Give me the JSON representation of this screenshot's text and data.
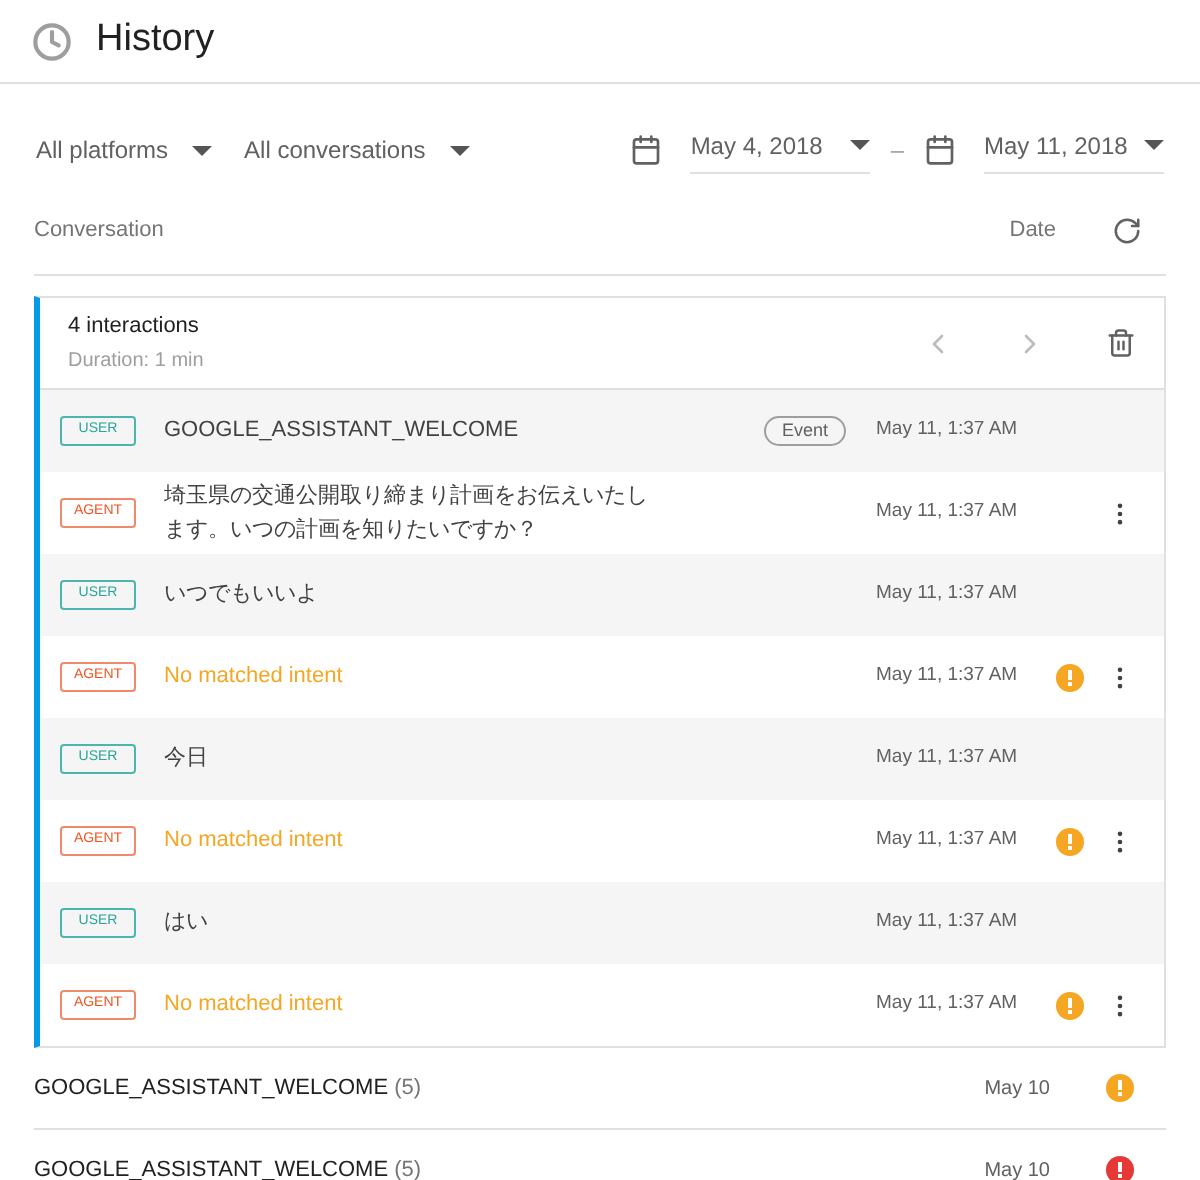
{
  "header": {
    "title": "History"
  },
  "filters": {
    "platform": "All platforms",
    "conversations": "All conversations",
    "date_from": "May 4, 2018",
    "separator": "–",
    "date_to": "May 11, 2018"
  },
  "columns": {
    "conversation": "Conversation",
    "date": "Date"
  },
  "expanded_conversation": {
    "title": "4 interactions",
    "duration": "Duration: 1 min",
    "messages": [
      {
        "kind": "user",
        "badge": "USER",
        "text": "GOOGLE_ASSISTANT_WELCOME",
        "tag": "Event",
        "time": "May 11, 1:37 AM",
        "warning": false,
        "menu": false
      },
      {
        "kind": "agent",
        "badge": "AGENT",
        "text": "埼玉県の交通公開取り締まり計画をお伝えいたします。いつの計画を知りたいですか？",
        "time": "May 11, 1:37 AM",
        "warning": false,
        "menu": true
      },
      {
        "kind": "user",
        "badge": "USER",
        "text": "いつでもいいよ",
        "time": "May 11, 1:37 AM",
        "warning": false,
        "menu": false
      },
      {
        "kind": "agent",
        "badge": "AGENT",
        "text": "No matched intent",
        "time": "May 11, 1:37 AM",
        "warning": true,
        "menu": true
      },
      {
        "kind": "user",
        "badge": "USER",
        "text": "今日",
        "time": "May 11, 1:37 AM",
        "warning": false,
        "menu": false
      },
      {
        "kind": "agent",
        "badge": "AGENT",
        "text": "No matched intent",
        "time": "May 11, 1:37 AM",
        "warning": true,
        "menu": true
      },
      {
        "kind": "user",
        "badge": "USER",
        "text": "はい",
        "time": "May 11, 1:37 AM",
        "warning": false,
        "menu": false
      },
      {
        "kind": "agent",
        "badge": "AGENT",
        "text": "No matched intent",
        "time": "May 11, 1:37 AM",
        "warning": true,
        "menu": true
      }
    ]
  },
  "conversations": [
    {
      "name": "GOOGLE_ASSISTANT_WELCOME",
      "count": "(5)",
      "date": "May 10",
      "color": "#f5a623"
    },
    {
      "name": "GOOGLE_ASSISTANT_WELCOME",
      "count": "(5)",
      "date": "May 10",
      "color": "#e53935"
    }
  ]
}
